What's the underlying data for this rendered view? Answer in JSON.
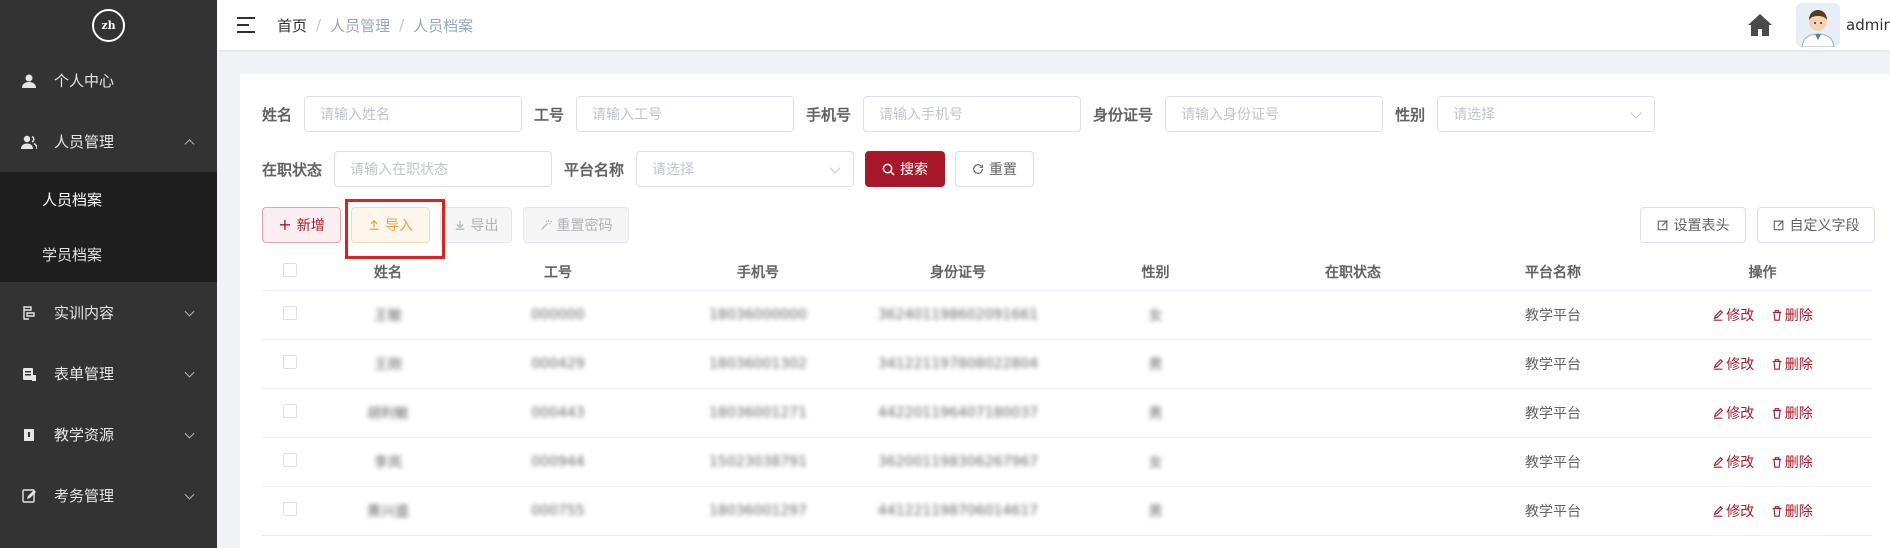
{
  "sidebar": {
    "logo_text": "zh",
    "menu": [
      {
        "label": "个人中心",
        "icon": "user-icon"
      },
      {
        "label": "人员管理",
        "icon": "users-icon",
        "expanded": true,
        "children": [
          {
            "label": "人员档案",
            "active": true
          },
          {
            "label": "学员档案",
            "active": false
          }
        ]
      },
      {
        "label": "实训内容",
        "icon": "training-icon"
      },
      {
        "label": "表单管理",
        "icon": "form-icon"
      },
      {
        "label": "教学资源",
        "icon": "resource-icon"
      },
      {
        "label": "考务管理",
        "icon": "exam-icon"
      }
    ]
  },
  "header": {
    "breadcrumb": [
      "首页",
      "人员管理",
      "人员档案"
    ],
    "username": "admin"
  },
  "search": {
    "name_label": "姓名",
    "name_placeholder": "请输入姓名",
    "jobno_label": "工号",
    "jobno_placeholder": "请输入工号",
    "phone_label": "手机号",
    "phone_placeholder": "请输入手机号",
    "idcard_label": "身份证号",
    "idcard_placeholder": "请输入身份证号",
    "gender_label": "性别",
    "gender_placeholder": "请选择",
    "status_label": "在职状态",
    "status_placeholder": "请输入在职状态",
    "platform_label": "平台名称",
    "platform_placeholder": "请选择",
    "search_btn": "搜索",
    "reset_btn": "重置"
  },
  "toolbar": {
    "new_btn": "新增",
    "import_btn": "导入",
    "export_btn": "导出",
    "resetpwd_btn": "重置密码",
    "set_header_btn": "设置表头",
    "custom_field_btn": "自定义字段"
  },
  "table": {
    "columns": [
      "姓名",
      "工号",
      "手机号",
      "身份证号",
      "性别",
      "在职状态",
      "平台名称",
      "操作"
    ],
    "rows": [
      {
        "name": "王敏",
        "jobno": "000000",
        "phone": "18036000000",
        "idcard": "362401198602091661",
        "gender": "女",
        "status": "",
        "platform": "教学平台"
      },
      {
        "name": "王刚",
        "jobno": "000429",
        "phone": "18036001302",
        "idcard": "341221197808022804",
        "gender": "男",
        "status": "",
        "platform": "教学平台"
      },
      {
        "name": "胡利敏",
        "jobno": "000443",
        "phone": "18036001271",
        "idcard": "442201196407180037",
        "gender": "男",
        "status": "",
        "platform": "教学平台"
      },
      {
        "name": "李岚",
        "jobno": "000944",
        "phone": "15023038791",
        "idcard": "362001198306267967",
        "gender": "女",
        "status": "",
        "platform": "教学平台"
      },
      {
        "name": "黄兴盛",
        "jobno": "000755",
        "phone": "18036001297",
        "idcard": "441221198706014617",
        "gender": "男",
        "status": "",
        "platform": "教学平台"
      }
    ],
    "edit_label": "修改",
    "delete_label": "删除"
  },
  "colors": {
    "primary": "#a8182a",
    "sidebar_bg": "#333333",
    "submenu_bg": "#1f1f1f"
  }
}
